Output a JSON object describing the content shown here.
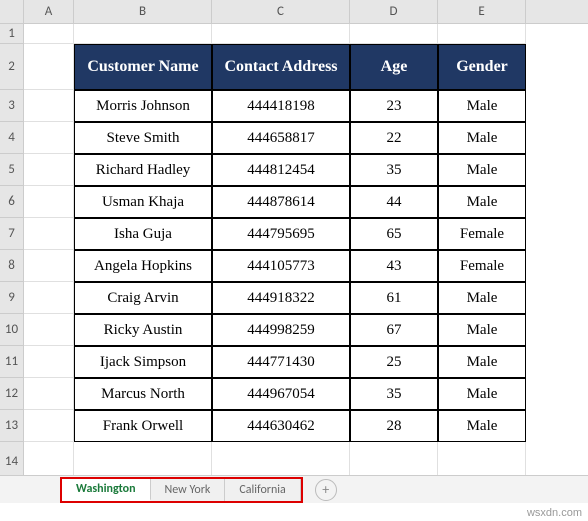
{
  "columns": [
    "A",
    "B",
    "C",
    "D",
    "E"
  ],
  "headers": {
    "name": "Customer Name",
    "contact": "Contact Address",
    "age": "Age",
    "gender": "Gender"
  },
  "rows": [
    {
      "n": "Morris Johnson",
      "c": "444418198",
      "a": "23",
      "g": "Male"
    },
    {
      "n": "Steve Smith",
      "c": "444658817",
      "a": "22",
      "g": "Male"
    },
    {
      "n": "Richard Hadley",
      "c": "444812454",
      "a": "35",
      "g": "Male"
    },
    {
      "n": "Usman Khaja",
      "c": "444878614",
      "a": "44",
      "g": "Male"
    },
    {
      "n": "Isha Guja",
      "c": "444795695",
      "a": "65",
      "g": "Female"
    },
    {
      "n": "Angela Hopkins",
      "c": "444105773",
      "a": "43",
      "g": "Female"
    },
    {
      "n": "Craig Arvin",
      "c": "444918322",
      "a": "61",
      "g": "Male"
    },
    {
      "n": "Ricky Austin",
      "c": "444998259",
      "a": "67",
      "g": "Male"
    },
    {
      "n": "Ijack Simpson",
      "c": "444771430",
      "a": "25",
      "g": "Male"
    },
    {
      "n": "Marcus North",
      "c": "444967054",
      "a": "35",
      "g": "Male"
    },
    {
      "n": "Frank Orwell",
      "c": "444630462",
      "a": "28",
      "g": "Male"
    }
  ],
  "rownums": [
    "1",
    "2",
    "3",
    "4",
    "5",
    "6",
    "7",
    "8",
    "9",
    "10",
    "11",
    "12",
    "13",
    "14"
  ],
  "tabs": {
    "active": "Washington",
    "t2": "New York",
    "t3": "California"
  },
  "watermark": "wsxdn.com",
  "chart_data": {
    "type": "table",
    "title": "",
    "columns": [
      "Customer Name",
      "Contact Address",
      "Age",
      "Gender"
    ],
    "data": [
      [
        "Morris Johnson",
        "444418198",
        23,
        "Male"
      ],
      [
        "Steve Smith",
        "444658817",
        22,
        "Male"
      ],
      [
        "Richard Hadley",
        "444812454",
        35,
        "Male"
      ],
      [
        "Usman Khaja",
        "444878614",
        44,
        "Male"
      ],
      [
        "Isha Guja",
        "444795695",
        65,
        "Female"
      ],
      [
        "Angela Hopkins",
        "444105773",
        43,
        "Female"
      ],
      [
        "Craig Arvin",
        "444918322",
        61,
        "Male"
      ],
      [
        "Ricky Austin",
        "444998259",
        67,
        "Male"
      ],
      [
        "Ijack Simpson",
        "444771430",
        25,
        "Male"
      ],
      [
        "Marcus North",
        "444967054",
        35,
        "Male"
      ],
      [
        "Frank Orwell",
        "444630462",
        28,
        "Male"
      ]
    ]
  }
}
